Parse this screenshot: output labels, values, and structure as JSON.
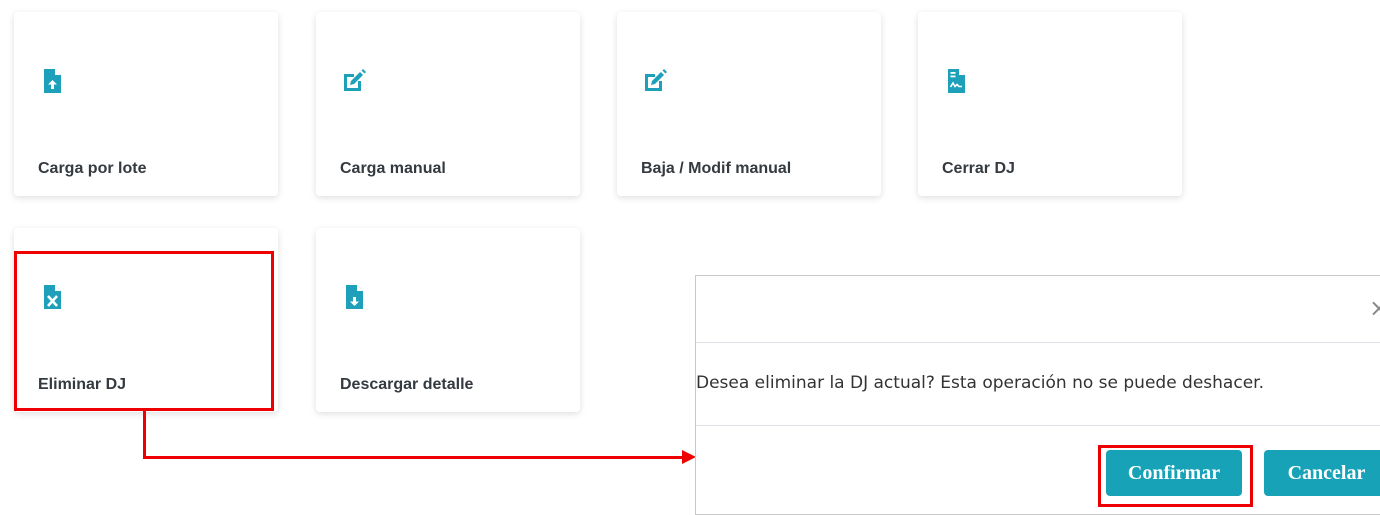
{
  "colors": {
    "accent": "#17a2b8",
    "icon": "#1ea0bb",
    "highlight": "#ee0000",
    "label": "#343a40"
  },
  "cards": [
    {
      "label": "Carga por lote",
      "icon": "file-upload-icon"
    },
    {
      "label": "Carga manual",
      "icon": "edit-icon"
    },
    {
      "label": "Baja / Modif manual",
      "icon": "edit-icon"
    },
    {
      "label": "Cerrar DJ",
      "icon": "file-signature-icon"
    },
    {
      "label": "Eliminar DJ",
      "icon": "file-excel-icon"
    },
    {
      "label": "Descargar detalle",
      "icon": "file-download-icon"
    }
  ],
  "modal": {
    "close_symbol": "×",
    "message": "Desea eliminar la DJ actual? Esta operación no se puede deshacer.",
    "confirm_label": "Confirmar",
    "cancel_label": "Cancelar"
  }
}
